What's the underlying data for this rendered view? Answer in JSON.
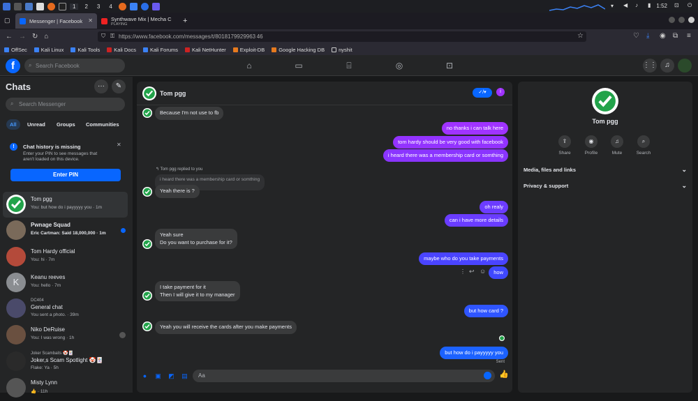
{
  "os": {
    "workspaces": [
      "1",
      "2",
      "3",
      "4"
    ],
    "clock": "1:52"
  },
  "browser": {
    "tabs": [
      {
        "label": "Messenger | Facebook",
        "sub": ""
      },
      {
        "label": "Synthwave Mix | Mecha C",
        "sub": "PLAYING"
      }
    ],
    "new_tab": "+",
    "url": "https://www.facebook.com/messages/t/8018179929963 46",
    "bookmarks": [
      "OffSec",
      "Kali Linux",
      "Kali Tools",
      "Kali Docs",
      "Kali Forums",
      "Kali NetHunter",
      "Exploit-DB",
      "Google Hacking DB",
      "nyshit"
    ]
  },
  "fb": {
    "logo": "f",
    "search_placeholder": "Search Facebook"
  },
  "sidebar": {
    "title": "Chats",
    "search_placeholder": "Search Messenger",
    "filters": [
      "All",
      "Unread",
      "Groups",
      "Communities"
    ],
    "notice_title": "Chat history is missing",
    "notice_body1": "Enter your PIN to see messages that",
    "notice_body2": "aren't loaded on this device.",
    "pin_button": "Enter PIN",
    "chats": [
      {
        "name": "Tom pgg",
        "sub": "You: but how do i payyyyy you · 1m",
        "bold": false,
        "color": "#22a34a"
      },
      {
        "name": "Pwnage Squad",
        "sub": "Eric Cartman: Said 18,000,000 · 1m",
        "bold": true,
        "color": "#7a6a5a"
      },
      {
        "name": "Tom Hardy official",
        "sub": "You: hi · 7m",
        "bold": false,
        "color": "#b44a3a"
      },
      {
        "name": "Keanu reeves",
        "sub": "You: hello · 7m",
        "bold": false,
        "color": "#8a8d91",
        "initial": "K"
      },
      {
        "name": "General chat",
        "pre": "DC404",
        "sub": "You sent a photo. · 39m",
        "bold": false,
        "color": "#4a4a6a"
      },
      {
        "name": "Niko DeRuise",
        "sub": "You: I was wrong · 1h",
        "bold": false,
        "color": "#6a5040"
      },
      {
        "name": "Joker,s Scam Spotlight 🤡🃏",
        "pre": "Joker Scambaits 🤡🃏",
        "sub": "Flake: Ya · 5h",
        "bold": false,
        "color": "#2a2a2a"
      },
      {
        "name": "Misty Lynn",
        "sub": "👍 · 11h",
        "bold": false,
        "color": "#555"
      }
    ]
  },
  "conversation": {
    "name": "Tom pgg",
    "reply_hint": "Tom pgg replied to you",
    "quoted": "i heard there was a membership card or somthing",
    "messages": [
      {
        "dir": "in",
        "text": "Because I'm not use to fb"
      },
      {
        "dir": "out",
        "text": "no thanks i can talk here"
      },
      {
        "dir": "out",
        "text": "tom hardy should be very good with facebook"
      },
      {
        "dir": "out",
        "text": "i heard there was a membership card or somthing"
      },
      {
        "dir": "in",
        "text": "Yeah there is ?"
      },
      {
        "dir": "out",
        "text": "oh realy"
      },
      {
        "dir": "out",
        "text": "can i have more details"
      },
      {
        "dir": "in",
        "text": "Yeah sure",
        "text2": "Do you want to purchase for it?"
      },
      {
        "dir": "out",
        "text": "maybe who do you take payments"
      },
      {
        "dir": "out",
        "text": "how"
      },
      {
        "dir": "in",
        "text": "I take payment for it",
        "text2": "Then I will give it to my manager"
      },
      {
        "dir": "out",
        "text": "but how card ?"
      },
      {
        "dir": "in",
        "text": "Yeah you will receive the cards after you make payments"
      },
      {
        "dir": "out",
        "text": "but how do i payyyyy you"
      }
    ],
    "status": "Sent",
    "composer_placeholder": "Aa"
  },
  "profile": {
    "name": "Tom pgg",
    "actions": [
      "Share",
      "Profile",
      "Mute",
      "Search"
    ],
    "sections": [
      "Media, files and links",
      "Privacy & support"
    ]
  },
  "colors": {
    "accent": "#0866ff",
    "verified": "#22a34a"
  }
}
